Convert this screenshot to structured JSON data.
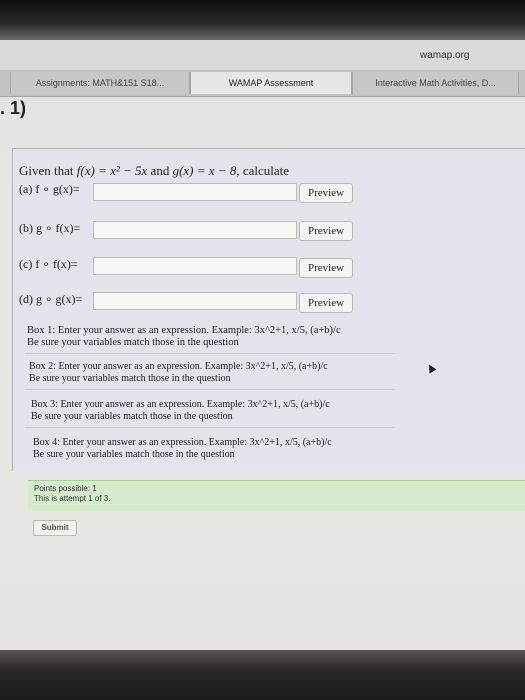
{
  "browser": {
    "url": "wamap.org",
    "tabs": [
      {
        "label": "Assignments: MATH&151 S18..."
      },
      {
        "label": "WAMAP Assessment"
      },
      {
        "label": "Interactive Math Activities, D..."
      }
    ]
  },
  "question": {
    "number": ". 1)",
    "prompt_prefix": "Given that ",
    "f_def": "f(x) = x² − 5x",
    "and_text": " and ",
    "g_def": "g(x) = x − 8",
    "prompt_suffix": ", calculate",
    "parts": [
      {
        "label": "(a) f ∘ g(x)=",
        "value": "",
        "preview_label": "Preview"
      },
      {
        "label": "(b) g ∘ f(x)=",
        "value": "",
        "preview_label": "Preview"
      },
      {
        "label": "(c) f ∘ f(x)=",
        "value": "",
        "preview_label": "Preview"
      },
      {
        "label": "(d) g ∘ g(x)=",
        "value": "",
        "preview_label": "Preview"
      }
    ],
    "instructions": [
      {
        "line1": "Box 1: Enter your answer as an expression. Example: 3x^2+1, x/5, (a+b)/c",
        "line2": "Be sure your variables match those in the question"
      },
      {
        "line1": "Box 2: Enter your answer as an expression. Example: 3x^2+1, x/5, (a+b)/c",
        "line2": "Be sure your variables match those in the question"
      },
      {
        "line1": "Box 3: Enter your answer as an expression. Example: 3x^2+1, x/5, (a+b)/c",
        "line2": "Be sure your variables match those in the question"
      },
      {
        "line1": "Box 4: Enter your answer as an expression. Example: 3x^2+1, x/5, (a+b)/c",
        "line2": "Be sure your variables match those in the question"
      }
    ]
  },
  "status": {
    "points": "Points possible: 1",
    "attempt": "This is attempt 1 of 3."
  },
  "submit_label": "Submit"
}
